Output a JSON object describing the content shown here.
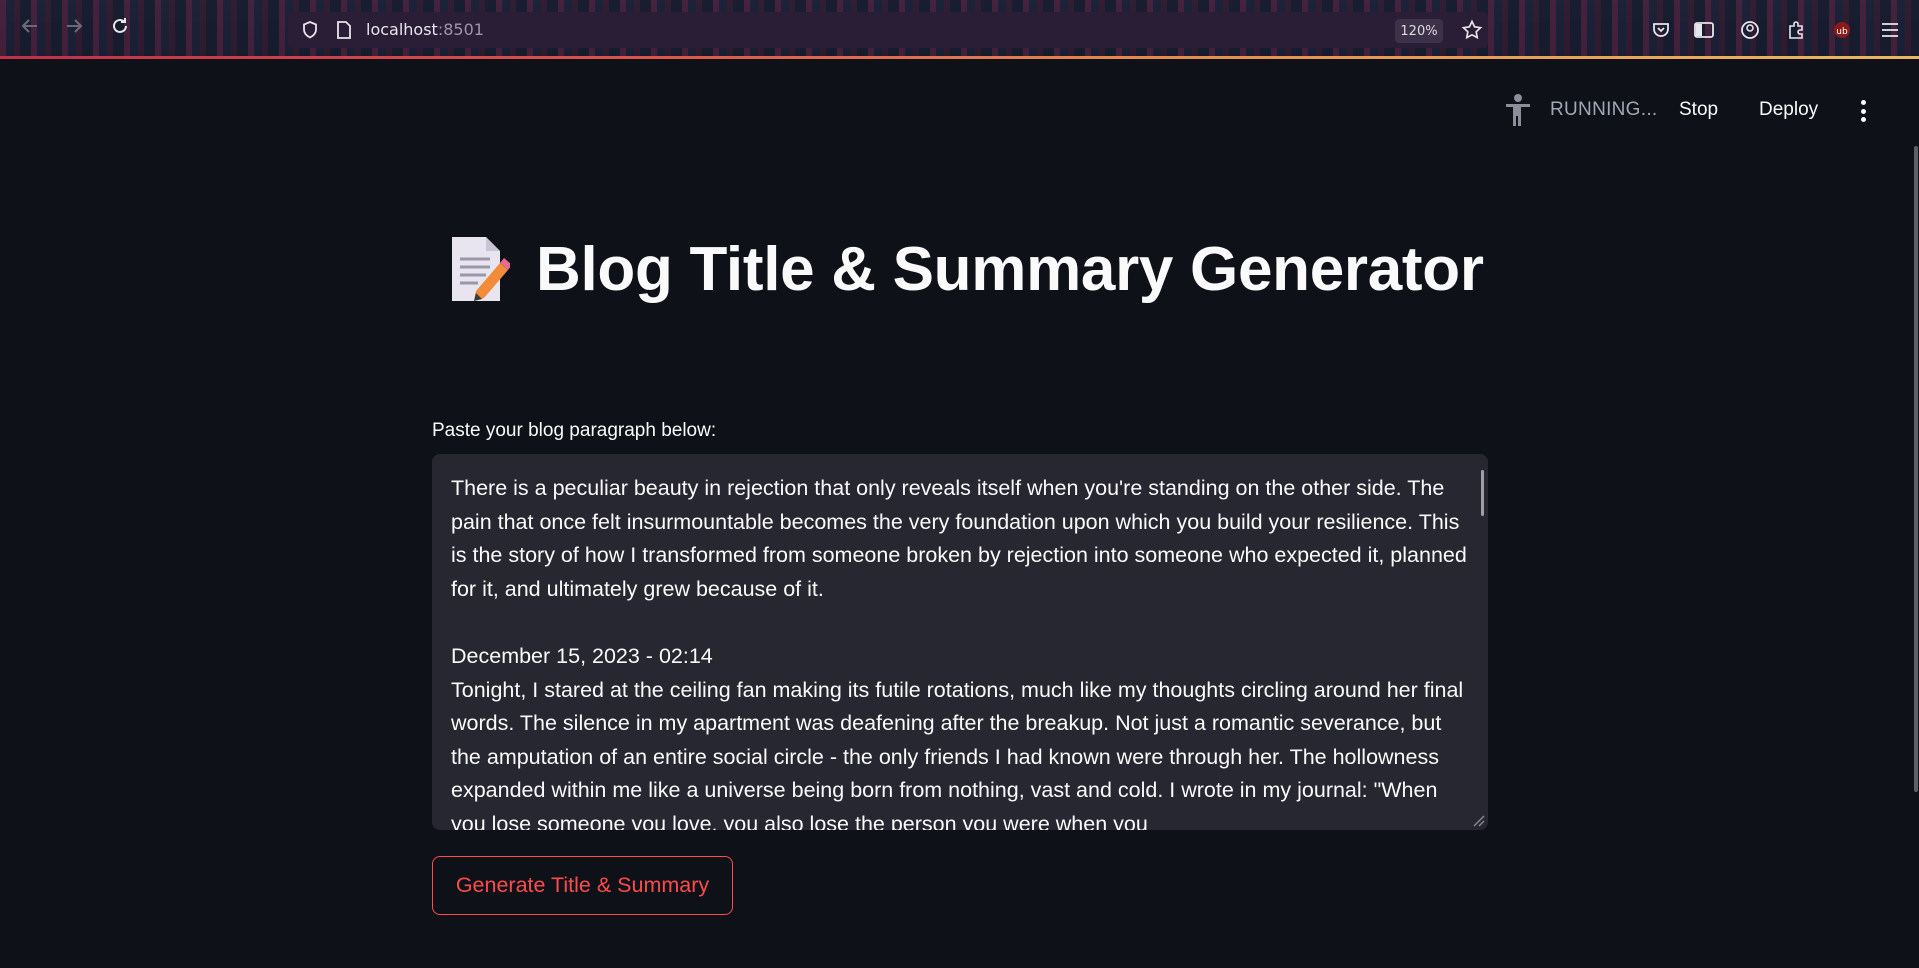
{
  "browser": {
    "url_host": "localhost",
    "url_port": ":8501",
    "zoom": "120%"
  },
  "header": {
    "status": "RUNNING...",
    "stop_label": "Stop",
    "deploy_label": "Deploy"
  },
  "main": {
    "title": "Blog Title & Summary Generator",
    "input_label": "Paste your blog paragraph below:",
    "textarea_value": "There is a peculiar beauty in rejection that only reveals itself when you're standing on the other side. The pain that once felt insurmountable becomes the very foundation upon which you build your resilience. This is the story of how I transformed from someone broken by rejection into someone who expected it, planned for it, and ultimately grew because of it.\n\nDecember 15, 2023 - 02:14\nTonight, I stared at the ceiling fan making its futile rotations, much like my thoughts circling around her final words. The silence in my apartment was deafening after the breakup. Not just a romantic severance, but the amputation of an entire social circle - the only friends I had known were through her. The hollowness expanded within me like a universe being born from nothing, vast and cold. I wrote in my journal: \"When you lose someone you love, you also lose the person you were when you",
    "generate_label": "Generate Title & Summary"
  },
  "colors": {
    "background": "#0e1117",
    "textarea_bg": "#262730",
    "primary": "#ff4b4b"
  }
}
